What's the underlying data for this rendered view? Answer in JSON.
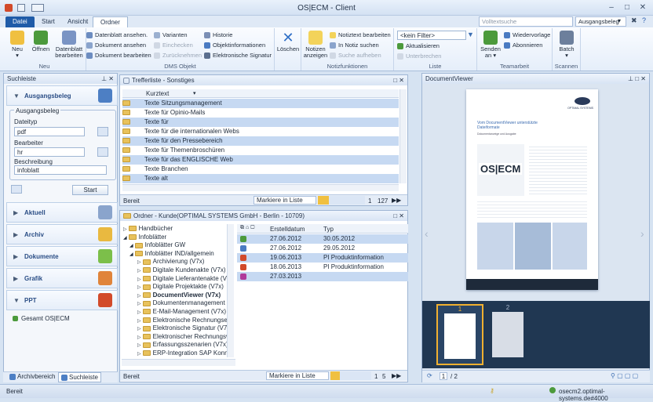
{
  "window": {
    "title": "OS|ECM  - Client"
  },
  "tabs": [
    "Datei",
    "Start",
    "Ansicht",
    "Ordner"
  ],
  "search": {
    "placeholder": "Volltextsuche",
    "scope": "Ausgangsbeleg"
  },
  "ribbon": {
    "neu": {
      "big": [
        "Neu",
        "Öffnen",
        "Datenblatt bearbeiten"
      ],
      "label": "Neu"
    },
    "dms": {
      "small": [
        "Datenblatt ansehen.",
        "Dokument ansehen",
        "Dokument bearbeiten",
        "Varianten",
        "Einchecken",
        "Zurücknehmen",
        "Historie",
        "Objektinformationen",
        "Elektronische Signatur"
      ],
      "big": [
        "Löschen"
      ],
      "label": "DMS Objekt"
    },
    "notiz": {
      "big": [
        "Notizen anzeigen"
      ],
      "small": [
        "Notiztext bearbeiten",
        "In Notiz suchen",
        "Suche aufheben"
      ],
      "label": "Notizfunktionen"
    },
    "liste": {
      "filter": "<kein Filter>",
      "small": [
        "Aktualisieren",
        "Unterbrechen"
      ],
      "label": "Liste"
    },
    "team": {
      "big": [
        "Senden an"
      ],
      "small": [
        "Wiedervorlage",
        "Abonnieren"
      ],
      "label": "Teamarbeit"
    },
    "scan": {
      "big": [
        "Batch"
      ],
      "label": "Scannen"
    }
  },
  "suchleiste": {
    "title": "Suchleiste",
    "section": "Ausgangsbeleg",
    "groupbox": "Ausgangsbeleg",
    "fields": [
      {
        "label": "Dateityp",
        "value": "pdf"
      },
      {
        "label": "Bearbeiter",
        "value": "hr"
      },
      {
        "label": "Beschreibung",
        "value": "infoblatt"
      }
    ],
    "start": "Start",
    "sections": [
      "Aktuell",
      "Archiv",
      "Dokumente",
      "Grafik",
      "PPT"
    ],
    "ppt_item": "Gesamt OS|ECM",
    "bottom_tabs": [
      "Archivbereich",
      "Suchleiste"
    ]
  },
  "trefferliste": {
    "title": "Trefferliste - Sonstiges",
    "column": "Kurztext",
    "rows": [
      "Texte Sitzungsmanagement",
      "Texte für Opinio-Mails",
      "Texte für",
      "Texte für die internationalen Webs",
      "Texte für den Pressebereich",
      "Texte für Themenbroschüren",
      "Texte für das ENGLISCHE Web",
      "Texte Branchen",
      "Texte alt"
    ],
    "status": "Bereit",
    "mark": "Markiere in Liste",
    "count": "1",
    "total": "127"
  },
  "ordner": {
    "title": "Ordner - Kunde(OPTIMAL SYSTEMS GmbH - Berlin - 10709)",
    "tree": [
      "Handbücher",
      "Infoblätter",
      "Infoblätter GW",
      "Infoblätter IND/allgemein",
      "Archivierung (V7x)",
      "Digitale Kundenakte (V7x)",
      "Digitale Lieferantenakte (V7x)",
      "Digitale Projektakte (V7x)",
      "DocumentViewer (V7x)",
      "Dokumentenmanagement",
      "E-Mail-Management (V7x)",
      "Elektronische Rechnungsei",
      "Elektronische Signatur (V7x)",
      "Elektronischer Rechnungsv",
      "Erfassungsszenarien (V7x)",
      "ERP-Integration SAP Konn"
    ],
    "columns": [
      "Erstelldatum",
      "Typ"
    ],
    "rows": [
      {
        "date": "27.06.2012",
        "typ": "30.05.2012"
      },
      {
        "date": "27.06.2012",
        "typ": "29.05.2012"
      },
      {
        "date": "19.06.2013",
        "typ": "PI Produktinformation"
      },
      {
        "date": "18.06.2013",
        "typ": "PI Produktinformation"
      },
      {
        "date": "27.03.2013",
        "typ": ""
      }
    ],
    "status": "Bereit",
    "mark": "Markiere in Liste",
    "count": "1",
    "total": "5"
  },
  "viewer": {
    "title": "DocumentViewer",
    "doc_logo": "OPTIMAL SYSTEMS",
    "doc_heading": "Vom DocumentViewer unterstützte Dateiformate",
    "doc_sub": "Dokumentanzeige und Ausgabe",
    "doc_brand": "OS|ECM",
    "thumbs": [
      "1",
      "2"
    ],
    "page": "1",
    "pages": "/ 2"
  },
  "statusbar": {
    "left": "Bereit",
    "right": "osecm2.optimal-systems.de#4000"
  },
  "colors": {
    "accent": "#1f5ba8",
    "selection": "#c6d9f2"
  }
}
